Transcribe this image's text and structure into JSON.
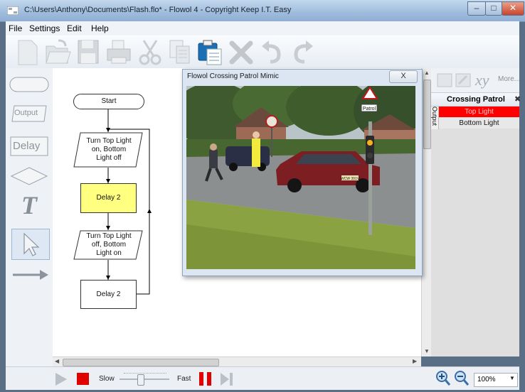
{
  "window": {
    "title": "C:\\Users\\Anthony\\Documents\\Flash.flo* - Flowol 4 - Copyright Keep I.T. Easy",
    "minimize": "–",
    "maximize": "□",
    "close": "✕"
  },
  "menu": [
    "File",
    "Settings",
    "Edit",
    "Help"
  ],
  "palette": {
    "output_label": "Output",
    "delay_label": "Delay",
    "text_label": "T"
  },
  "flowchart": {
    "start": "Start",
    "step1": [
      "Turn Top Light",
      "on, Bottom",
      "Light off"
    ],
    "delay1": "Delay 2",
    "step2": [
      "Turn Top Light",
      "off, Bottom",
      "Light on"
    ],
    "delay2": "Delay 2"
  },
  "mimic": {
    "title": "Flowol Crossing Patrol Mimic",
    "close": "X",
    "sign_text": "Patrol",
    "plate_text": "WCW 391V"
  },
  "right_panel": {
    "more": "More...",
    "xy": "xy",
    "header": "Crossing Patrol",
    "section_label": "Output",
    "outputs": [
      {
        "label": "Top Light",
        "active": true,
        "color": "#ff0000"
      },
      {
        "label": "Bottom Light",
        "active": false,
        "color": "#e8e8e8"
      }
    ]
  },
  "run_controls": {
    "slow": "Slow",
    "fast": "Fast",
    "speed_fraction": 0.4,
    "stop_color": "#e00000",
    "pause_color": "#e00000"
  },
  "zoom": {
    "value": "100%"
  }
}
